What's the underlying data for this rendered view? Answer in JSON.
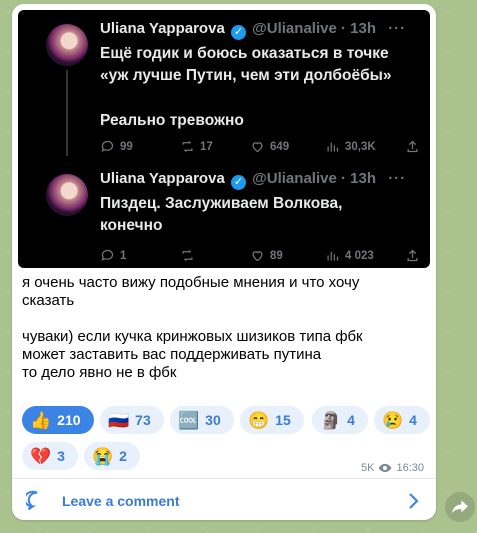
{
  "tweets": [
    {
      "name": "Uliana Yapparova",
      "handle": "@Ulianalive",
      "time": "13h",
      "text_lines": [
        "Ещё годик и боюсь оказаться в точке",
        "«уж лучше Путин, чем эти долбоёбы»"
      ],
      "text2": "Реально тревожно",
      "replies": "99",
      "reposts": "17",
      "likes": "649",
      "views": "30,3K"
    },
    {
      "name": "Uliana Yapparova",
      "handle": "@Ulianalive",
      "time": "13h",
      "text_lines": [
        "Пиздец. Заслуживаем Волкова,",
        "конечно"
      ],
      "replies": "1",
      "reposts": "",
      "likes": "89",
      "views": "4 023"
    }
  ],
  "message": {
    "line1": "я очень часто вижу подобные мнения и что хочу",
    "line2": "сказать",
    "line3": "чуваки) если кучка кринжовых шизиков типа фбк",
    "line4": "может заставить вас поддерживать путина",
    "line5": "то дело явно не в фбк"
  },
  "reactions": [
    {
      "emoji": "👍",
      "count": "210",
      "active": true
    },
    {
      "emoji": "🇷🇺",
      "count": "73",
      "active": false
    },
    {
      "emoji": "🆒",
      "count": "30",
      "active": false
    },
    {
      "emoji": "😁",
      "count": "15",
      "active": false
    },
    {
      "emoji": "🗿",
      "count": "4",
      "active": false
    },
    {
      "emoji": "😢",
      "count": "4",
      "active": false
    },
    {
      "emoji": "💔",
      "count": "3",
      "active": false
    },
    {
      "emoji": "😭",
      "count": "2",
      "active": false
    }
  ],
  "meta": {
    "views": "5K",
    "time": "16:30"
  },
  "comment": {
    "label": "Leave a comment"
  },
  "colors": {
    "accent": "#3b83e4",
    "tweet_bg": "#000000",
    "chat_bg": "#a9c28e"
  }
}
